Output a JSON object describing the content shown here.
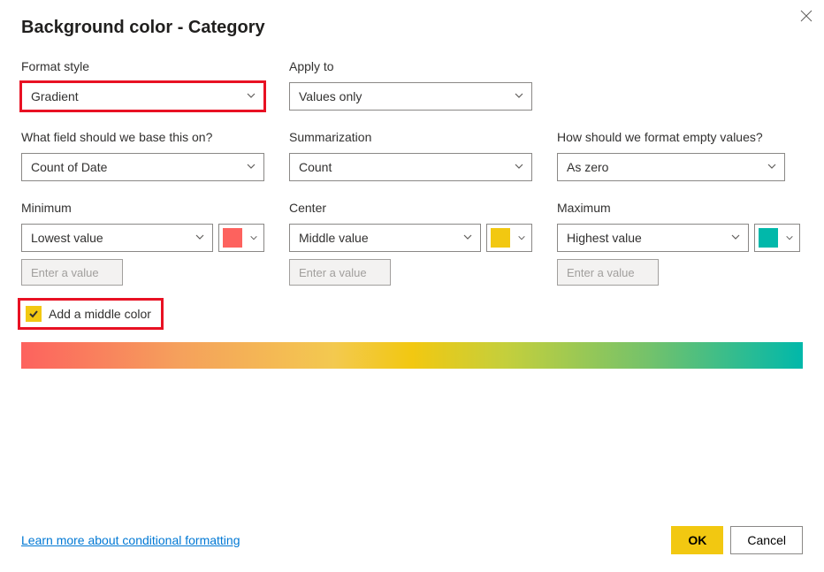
{
  "dialog": {
    "title": "Background color - Category"
  },
  "fields": {
    "format_style": {
      "label": "Format style",
      "value": "Gradient"
    },
    "apply_to": {
      "label": "Apply to",
      "value": "Values only"
    },
    "base_field": {
      "label": "What field should we base this on?",
      "value": "Count of Date"
    },
    "summarization": {
      "label": "Summarization",
      "value": "Count"
    },
    "empty_values": {
      "label": "How should we format empty values?",
      "value": "As zero"
    },
    "minimum": {
      "label": "Minimum",
      "value": "Lowest value",
      "placeholder": "Enter a value",
      "color": "#fd625e"
    },
    "center": {
      "label": "Center",
      "value": "Middle value",
      "placeholder": "Enter a value",
      "color": "#f2c811"
    },
    "maximum": {
      "label": "Maximum",
      "value": "Highest value",
      "placeholder": "Enter a value",
      "color": "#01b8aa"
    }
  },
  "checkbox": {
    "label": "Add a middle color",
    "checked": true
  },
  "footer": {
    "link": "Learn more about conditional formatting",
    "ok": "OK",
    "cancel": "Cancel"
  }
}
